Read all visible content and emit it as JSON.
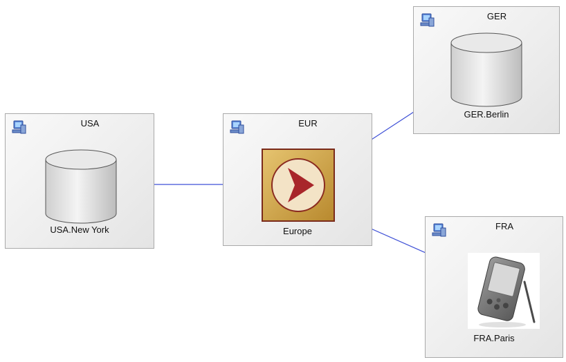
{
  "nodes": {
    "usa": {
      "title": "USA",
      "caption": "USA.New York"
    },
    "eur": {
      "title": "EUR",
      "caption": "Europe"
    },
    "ger": {
      "title": "GER",
      "caption": "GER.Berlin"
    },
    "fra": {
      "title": "FRA",
      "caption": "FRA.Paris"
    }
  },
  "colors": {
    "connector": "#3d4fd6",
    "hub_fill": "#c9a04a",
    "hub_arrow": "#a8262a"
  },
  "icons": [
    "server-icon",
    "database-icon",
    "replication-hub-icon",
    "pda-device-icon"
  ]
}
